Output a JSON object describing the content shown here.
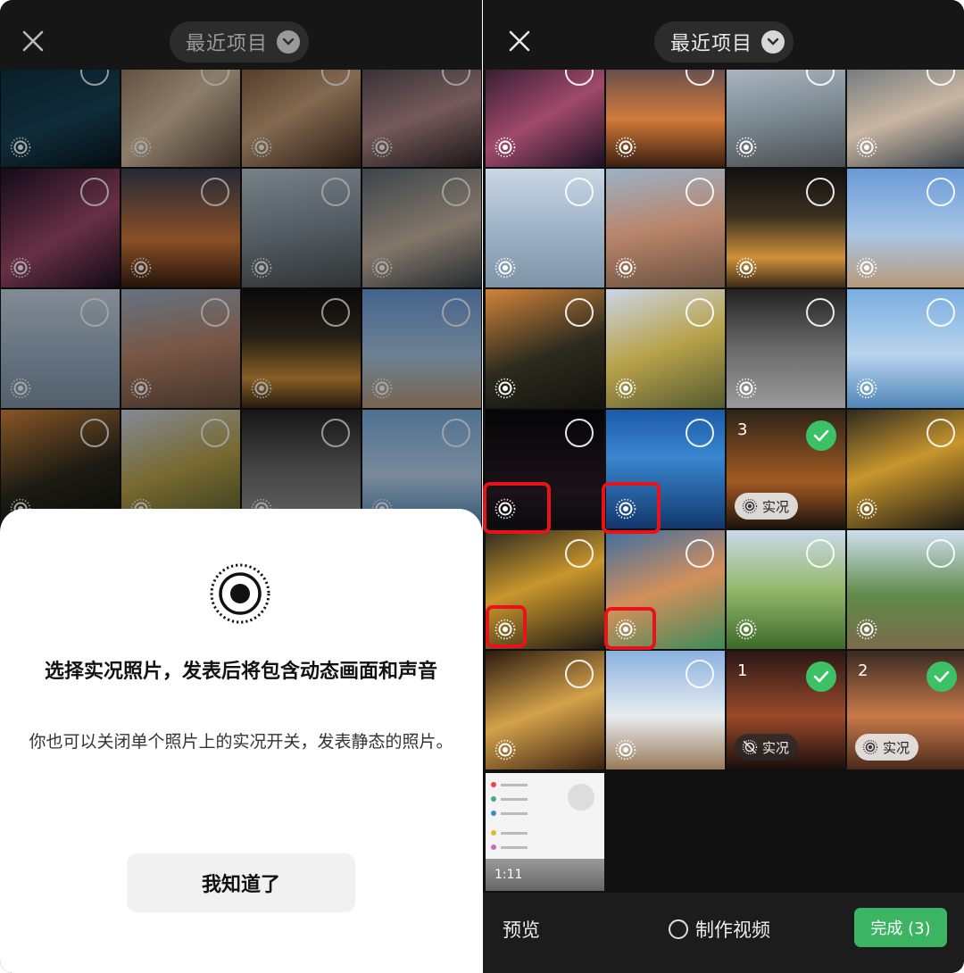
{
  "left": {
    "album_title": "最近项目",
    "sheet": {
      "title": "选择实况照片，发表后将包含动态画面和声音",
      "desc": "你也可以关闭单个照片上的实况开关，发表静态的照片。",
      "button": "我知道了"
    }
  },
  "right": {
    "album_title": "最近项目",
    "selections": [
      {
        "number": "3",
        "live_label": "实况"
      },
      {
        "number": "1",
        "live_label": "实况"
      },
      {
        "number": "2",
        "live_label": "实况"
      }
    ],
    "screenshot_time": "1:11",
    "bottom": {
      "preview": "预览",
      "make_video": "制作视频",
      "done": "完成 (3)"
    }
  },
  "colors": {
    "accent_green": "#3cc166",
    "highlight_red": "#e8121a"
  },
  "icons": [
    "close-icon",
    "chevron-down-icon",
    "live-photo-icon",
    "check-icon"
  ]
}
